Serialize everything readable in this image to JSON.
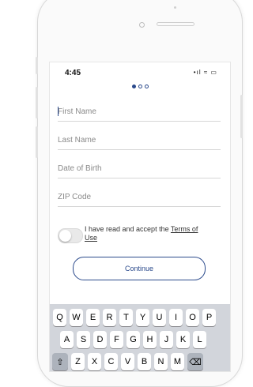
{
  "status": {
    "time": "4:45",
    "icons": "•ıl ≈ ▭"
  },
  "progress": {
    "step": 1,
    "total": 3
  },
  "form": {
    "first_name": {
      "placeholder": "First Name"
    },
    "last_name": {
      "placeholder": "Last Name"
    },
    "dob": {
      "placeholder": "Date of Birth"
    },
    "zip": {
      "placeholder": "ZIP Code"
    }
  },
  "terms": {
    "text": "I have read and accept the",
    "link": "Terms of Use",
    "accepted": false
  },
  "continue_label": "Continue",
  "keyboard": {
    "row1": [
      "Q",
      "W",
      "E",
      "R",
      "T",
      "Y",
      "U",
      "I",
      "O",
      "P"
    ],
    "row2": [
      "A",
      "S",
      "D",
      "F",
      "G",
      "H",
      "J",
      "K",
      "L"
    ],
    "row3": [
      "Z",
      "X",
      "C",
      "V",
      "B",
      "N",
      "M"
    ],
    "shift_icon": "shift-icon",
    "backspace_icon": "backspace-icon"
  },
  "colors": {
    "accent": "#2b4a8c"
  }
}
